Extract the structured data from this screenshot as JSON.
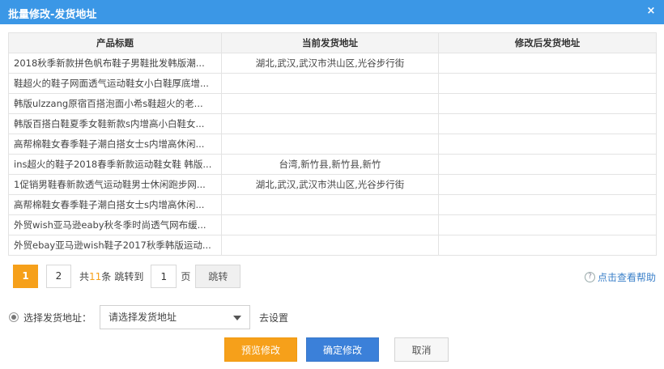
{
  "dialog": {
    "title": "批量修改-发货地址",
    "close_symbol": "×"
  },
  "table": {
    "headers": [
      "产品标题",
      "当前发货地址",
      "修改后发货地址"
    ],
    "rows": [
      {
        "title": "2018秋季新款拼色帆布鞋子男鞋批发韩版潮...",
        "current": "湖北,武汉,武汉市洪山区,光谷步行街",
        "new": ""
      },
      {
        "title": "鞋超火的鞋子网面透气运动鞋女小白鞋厚底增...",
        "current": "",
        "new": ""
      },
      {
        "title": "韩版ulzzang原宿百搭泡面小希s鞋超火的老...",
        "current": "",
        "new": ""
      },
      {
        "title": "韩版百搭白鞋夏季女鞋新款s内增高小白鞋女...",
        "current": "",
        "new": ""
      },
      {
        "title": "高帮棉鞋女春季鞋子潮白搭女士s内增高休闲...",
        "current": "",
        "new": ""
      },
      {
        "title": "ins超火的鞋子2018春季新款运动鞋女鞋 韩版...",
        "current": "台湾,新竹县,新竹县,新竹",
        "new": ""
      },
      {
        "title": "1促销男鞋春新款透气运动鞋男士休闲跑步网...",
        "current": "湖北,武汉,武汉市洪山区,光谷步行街",
        "new": ""
      },
      {
        "title": "高帮棉鞋女春季鞋子潮白搭女士s内增高休闲...",
        "current": "",
        "new": ""
      },
      {
        "title": "外贸wish亚马逊eaby秋冬季时尚透气网布缓...",
        "current": "",
        "new": ""
      },
      {
        "title": "外贸ebay亚马逊wish鞋子2017秋季韩版运动...",
        "current": "",
        "new": ""
      }
    ]
  },
  "pager": {
    "pages": [
      "1",
      "2"
    ],
    "total_prefix": "共",
    "total_count": "11",
    "total_suffix": "条",
    "jump_label": "跳转到",
    "jump_value": "1",
    "page_unit": "页",
    "go_label": "跳转"
  },
  "help": {
    "icon_text": "?",
    "label": "点击查看帮助"
  },
  "address": {
    "label": "选择发货地址：",
    "select_value": "请选择发货地址",
    "settings_label": "去设置"
  },
  "actions": {
    "preview_label": "预览修改",
    "confirm_label": "确定修改",
    "cancel_label": "取消"
  },
  "colors": {
    "titlebar": "#3b97e6",
    "accent_orange": "#f6a01a",
    "primary_blue": "#3b80d9"
  }
}
